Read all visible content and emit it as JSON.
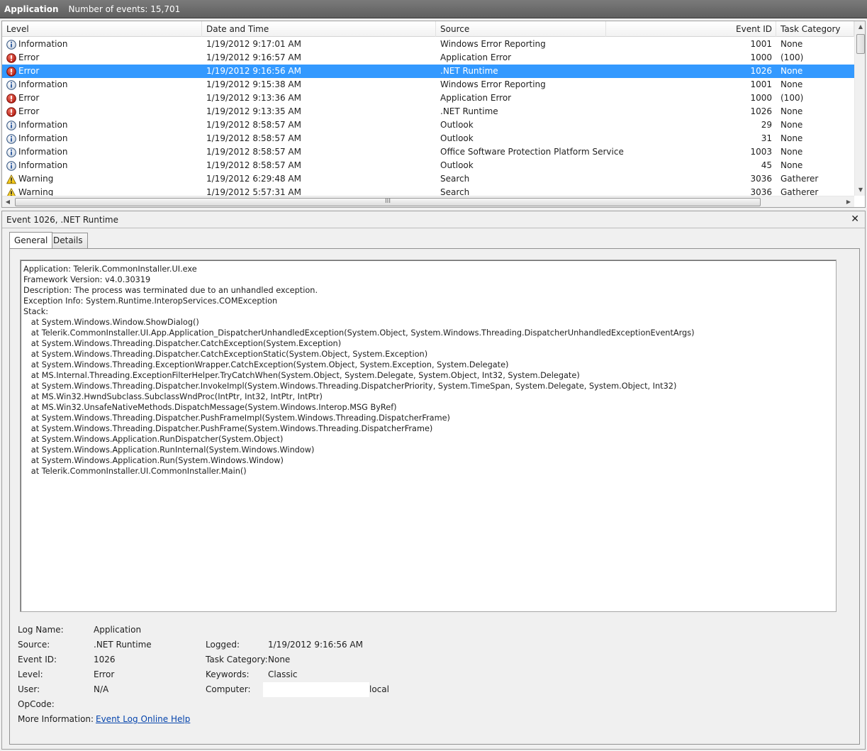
{
  "titlebar": {
    "title": "Application",
    "count": "Number of events: 15,701"
  },
  "columns": {
    "level": "Level",
    "datetime": "Date and Time",
    "source": "Source",
    "eventid": "Event ID",
    "category": "Task Category"
  },
  "rows": [
    {
      "icon": "information-icon",
      "level": "Information",
      "datetime": "1/19/2012 9:17:01 AM",
      "source": "Windows Error Reporting",
      "eventid": "1001",
      "category": "None",
      "selected": false
    },
    {
      "icon": "error-icon",
      "level": "Error",
      "datetime": "1/19/2012 9:16:57 AM",
      "source": "Application Error",
      "eventid": "1000",
      "category": "(100)",
      "selected": false
    },
    {
      "icon": "error-icon",
      "level": "Error",
      "datetime": "1/19/2012 9:16:56 AM",
      "source": ".NET Runtime",
      "eventid": "1026",
      "category": "None",
      "selected": true
    },
    {
      "icon": "information-icon",
      "level": "Information",
      "datetime": "1/19/2012 9:15:38 AM",
      "source": "Windows Error Reporting",
      "eventid": "1001",
      "category": "None",
      "selected": false
    },
    {
      "icon": "error-icon",
      "level": "Error",
      "datetime": "1/19/2012 9:13:36 AM",
      "source": "Application Error",
      "eventid": "1000",
      "category": "(100)",
      "selected": false
    },
    {
      "icon": "error-icon",
      "level": "Error",
      "datetime": "1/19/2012 9:13:35 AM",
      "source": ".NET Runtime",
      "eventid": "1026",
      "category": "None",
      "selected": false
    },
    {
      "icon": "information-icon",
      "level": "Information",
      "datetime": "1/19/2012 8:58:57 AM",
      "source": "Outlook",
      "eventid": "29",
      "category": "None",
      "selected": false
    },
    {
      "icon": "information-icon",
      "level": "Information",
      "datetime": "1/19/2012 8:58:57 AM",
      "source": "Outlook",
      "eventid": "31",
      "category": "None",
      "selected": false
    },
    {
      "icon": "information-icon",
      "level": "Information",
      "datetime": "1/19/2012 8:58:57 AM",
      "source": "Office Software Protection Platform Service",
      "eventid": "1003",
      "category": "None",
      "selected": false
    },
    {
      "icon": "information-icon",
      "level": "Information",
      "datetime": "1/19/2012 8:58:57 AM",
      "source": "Outlook",
      "eventid": "45",
      "category": "None",
      "selected": false
    },
    {
      "icon": "warning-icon",
      "level": "Warning",
      "datetime": "1/19/2012 6:29:48 AM",
      "source": "Search",
      "eventid": "3036",
      "category": "Gatherer",
      "selected": false
    },
    {
      "icon": "warning-icon",
      "level": "Warning",
      "datetime": "1/19/2012 5:57:31 AM",
      "source": "Search",
      "eventid": "3036",
      "category": "Gatherer",
      "selected": false
    }
  ],
  "scroll": {
    "h_grip": "III"
  },
  "detail": {
    "title": "Event 1026, .NET Runtime",
    "close": "✕",
    "tabs": {
      "general": "General",
      "details": "Details"
    },
    "message": [
      "Application: Telerik.CommonInstaller.UI.exe",
      "Framework Version: v4.0.30319",
      "Description: The process was terminated due to an unhandled exception.",
      "Exception Info: System.Runtime.InteropServices.COMException",
      "Stack:",
      "   at System.Windows.Window.ShowDialog()",
      "   at Telerik.CommonInstaller.UI.App.Application_DispatcherUnhandledException(System.Object, System.Windows.Threading.DispatcherUnhandledExceptionEventArgs)",
      "   at System.Windows.Threading.Dispatcher.CatchException(System.Exception)",
      "   at System.Windows.Threading.Dispatcher.CatchExceptionStatic(System.Object, System.Exception)",
      "   at System.Windows.Threading.ExceptionWrapper.CatchException(System.Object, System.Exception, System.Delegate)",
      "   at MS.Internal.Threading.ExceptionFilterHelper.TryCatchWhen(System.Object, System.Delegate, System.Object, Int32, System.Delegate)",
      "   at System.Windows.Threading.Dispatcher.InvokeImpl(System.Windows.Threading.DispatcherPriority, System.TimeSpan, System.Delegate, System.Object, Int32)",
      "   at MS.Win32.HwndSubclass.SubclassWndProc(IntPtr, Int32, IntPtr, IntPtr)",
      "   at MS.Win32.UnsafeNativeMethods.DispatchMessage(System.Windows.Interop.MSG ByRef)",
      "   at System.Windows.Threading.Dispatcher.PushFrameImpl(System.Windows.Threading.DispatcherFrame)",
      "   at System.Windows.Threading.Dispatcher.PushFrame(System.Windows.Threading.DispatcherFrame)",
      "   at System.Windows.Application.RunDispatcher(System.Object)",
      "   at System.Windows.Application.RunInternal(System.Windows.Window)",
      "   at System.Windows.Application.Run(System.Windows.Window)",
      "   at Telerik.CommonInstaller.UI.CommonInstaller.Main()"
    ],
    "props": {
      "log_name_label": "Log Name:",
      "log_name": "Application",
      "source_label": "Source:",
      "source": ".NET Runtime",
      "logged_label": "Logged:",
      "logged": "1/19/2012 9:16:56 AM",
      "event_id_label": "Event ID:",
      "event_id": "1026",
      "task_category_label": "Task Category:",
      "task_category": "None",
      "level_label": "Level:",
      "level": "Error",
      "keywords_label": "Keywords:",
      "keywords": "Classic",
      "user_label": "User:",
      "user": "N/A",
      "computer_label": "Computer:",
      "computer_suffix": "local",
      "opcode_label": "OpCode:",
      "more_info_label": "More Information:",
      "more_info_link": "Event Log Online Help"
    }
  }
}
